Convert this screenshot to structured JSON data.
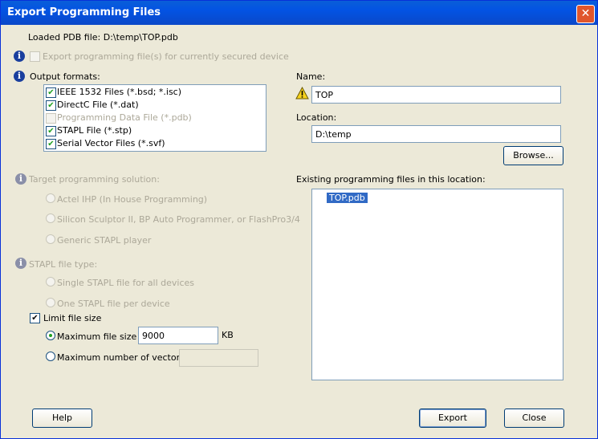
{
  "window": {
    "title": "Export Programming Files",
    "close_glyph": "✕"
  },
  "loaded_pdb": "Loaded PDB file: D:\\temp\\TOP.pdb",
  "secured": {
    "label": "Export programming file(s) for currently secured device",
    "checked": false
  },
  "output_formats": {
    "label": "Output formats:",
    "items": [
      {
        "label": "IEEE 1532 Files (*.bsd; *.isc)",
        "checked": true
      },
      {
        "label": "DirectC File (*.dat)",
        "checked": true
      },
      {
        "label": "Programming Data File (*.pdb)",
        "checked": false
      },
      {
        "label": "STAPL File (*.stp)",
        "checked": true
      },
      {
        "label": "Serial Vector Files (*.svf)",
        "checked": true
      }
    ]
  },
  "target": {
    "label": "Target programming solution:",
    "options": [
      "Actel IHP (In House Programming)",
      "Silicon Sculptor II, BP Auto Programmer, or FlashPro3/4",
      "Generic STAPL player"
    ]
  },
  "stapl_type": {
    "label": "STAPL file type:",
    "options": [
      "Single STAPL file for all devices",
      "One STAPL file per device"
    ]
  },
  "limit": {
    "label": "Limit file size",
    "checked": true,
    "max_size_label": "Maximum file size",
    "max_size_value": "9000",
    "unit": "KB",
    "max_vectors_label": "Maximum number of vectors",
    "max_vectors_value": ""
  },
  "name": {
    "label": "Name:",
    "value": "TOP"
  },
  "location": {
    "label": "Location:",
    "value": "D:\\temp",
    "browse": "Browse..."
  },
  "existing": {
    "label": "Existing programming files in this location:",
    "files": [
      "TOP.pdb"
    ]
  },
  "buttons": {
    "help": "Help",
    "export": "Export",
    "close": "Close"
  },
  "icons": {
    "info": "info-icon",
    "warning": "warning-icon"
  }
}
